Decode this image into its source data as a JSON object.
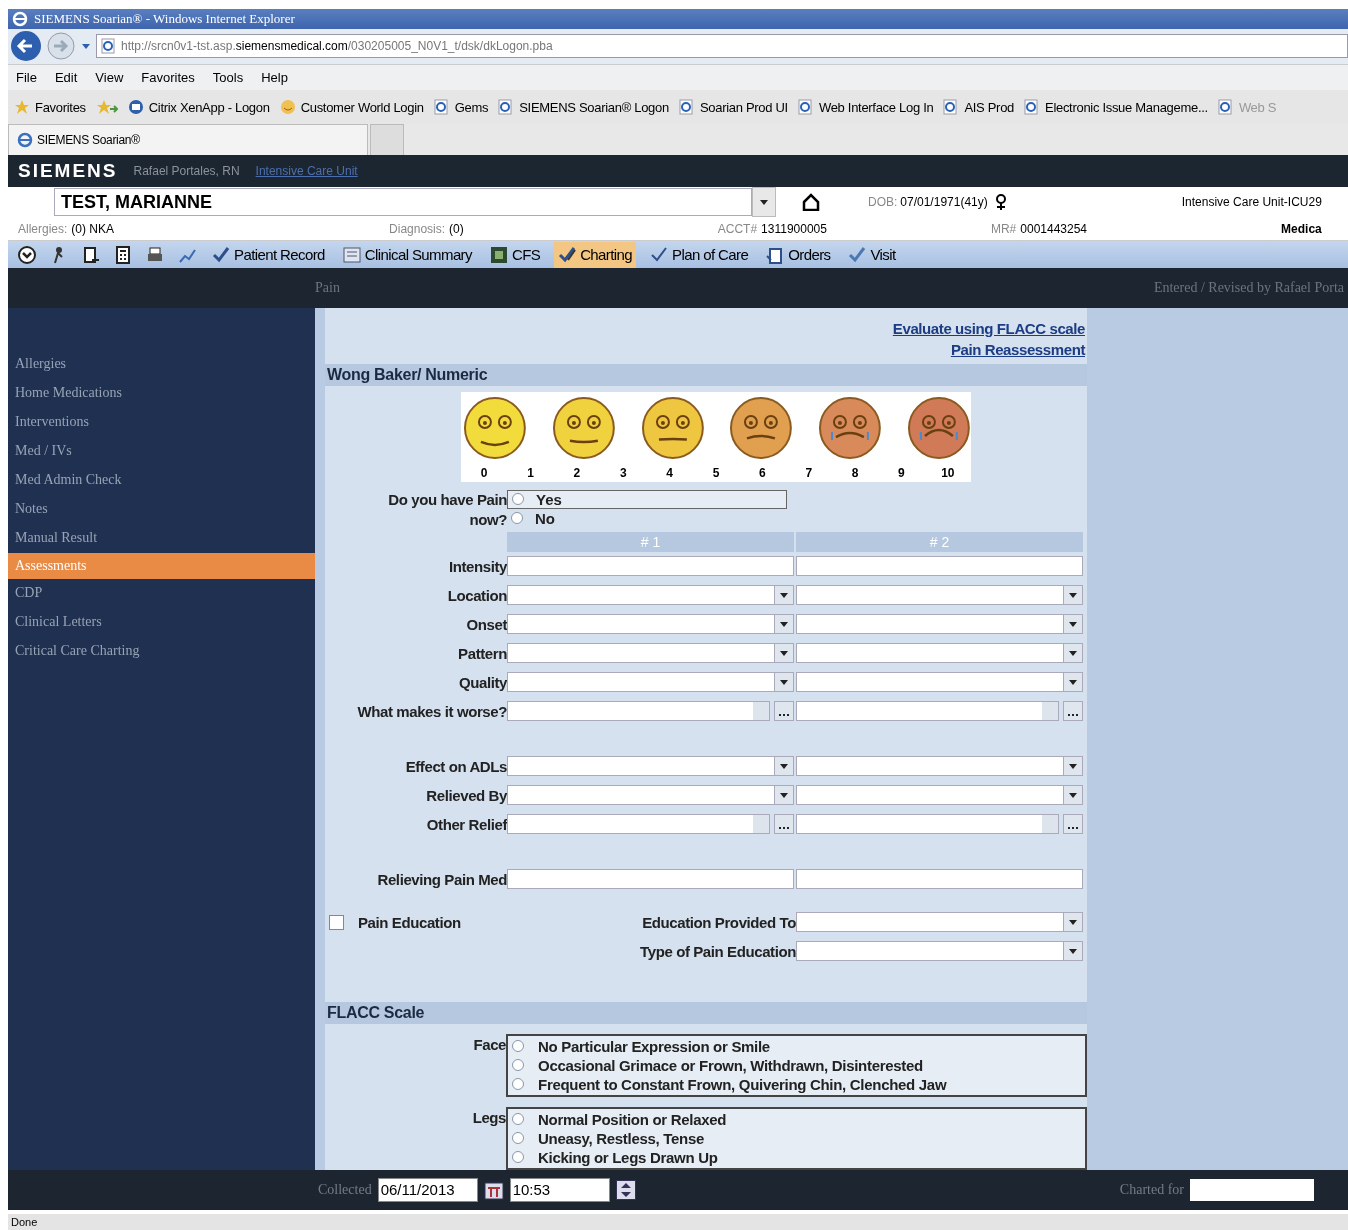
{
  "browser": {
    "title": "SIEMENS Soarian® - Windows Internet Explorer",
    "url": "http://srcn0v1-tst.asp.siemensmedical.com/030205005_N0V1_t/dsk/dkLogon.pba",
    "menu": [
      "File",
      "Edit",
      "View",
      "Favorites",
      "Tools",
      "Help"
    ],
    "favorites_label": "Favorites",
    "bookmarks": [
      {
        "label": "Citrix XenApp - Logon",
        "kind": "citrix"
      },
      {
        "label": "Customer World Login",
        "kind": "smile"
      },
      {
        "label": "Gems",
        "kind": "page"
      },
      {
        "label": "SIEMENS Soarian® Logon",
        "kind": "page"
      },
      {
        "label": "Soarian Prod UI",
        "kind": "page"
      },
      {
        "label": "Web Interface Log In",
        "kind": "page"
      },
      {
        "label": "AIS Prod",
        "kind": "page"
      },
      {
        "label": "Electronic Issue Manageme...",
        "kind": "page"
      },
      {
        "label": "Web S",
        "kind": "page"
      }
    ],
    "tab": "SIEMENS Soarian®",
    "status": "Done"
  },
  "app": {
    "brand": "SIEMENS",
    "user": "Rafael Portales, RN",
    "unit_link": "Intensive Care Unit"
  },
  "patient": {
    "name": "TEST, MARIANNE",
    "dob_label": "DOB:",
    "dob": "07/01/1971(41y)",
    "location": "Intensive Care Unit-ICU29",
    "allergies_label": "Allergies:",
    "allergies": "(0) NKA",
    "diagnosis_label": "Diagnosis:",
    "diagnosis": "(0)",
    "acct_label": "ACCT#",
    "acct": "1311900005",
    "mr_label": "MR#",
    "mr": "0001443254",
    "extra": "Medica"
  },
  "toolbar": {
    "tabs": [
      {
        "label": "Patient Record",
        "selected": false
      },
      {
        "label": "Clinical Summary",
        "selected": false
      },
      {
        "label": "CFS",
        "selected": false
      },
      {
        "label": "Charting",
        "selected": true
      },
      {
        "label": "Plan of Care",
        "selected": false
      },
      {
        "label": "Orders",
        "selected": false
      },
      {
        "label": "Visit",
        "selected": false
      }
    ]
  },
  "sidebar": {
    "items": [
      {
        "label": "Allergies",
        "selected": false
      },
      {
        "label": "Home Medications",
        "selected": false
      },
      {
        "label": "Interventions",
        "selected": false
      },
      {
        "label": "Med / IVs",
        "selected": false
      },
      {
        "label": "Med Admin Check",
        "selected": false
      },
      {
        "label": "Notes",
        "selected": false
      },
      {
        "label": "Manual Result",
        "selected": false
      },
      {
        "label": "Assessments",
        "selected": true
      },
      {
        "label": "CDP",
        "selected": false
      },
      {
        "label": "Clinical Letters",
        "selected": false
      },
      {
        "label": "Critical Care Charting",
        "selected": false
      }
    ]
  },
  "panel": {
    "title": "Pain",
    "entered": "Entered / Revised by  Rafael Porta"
  },
  "form": {
    "links": [
      "Evaluate using FLACC scale",
      "Pain Reassessment"
    ],
    "wong_title": "Wong Baker/ Numeric",
    "faces": [
      {
        "color": "#f2dc3c"
      },
      {
        "color": "#f0d23e"
      },
      {
        "color": "#eec640"
      },
      {
        "color": "#e0a050"
      },
      {
        "color": "#d98a5a"
      },
      {
        "color": "#d07a58"
      }
    ],
    "scale": [
      "0",
      "1",
      "2",
      "3",
      "4",
      "5",
      "6",
      "7",
      "8",
      "9",
      "10"
    ],
    "pain_question": "Do you have Pain now?",
    "pain_options": [
      {
        "label": "Yes",
        "selected": false
      },
      {
        "label": "No",
        "selected": false
      }
    ],
    "columns": [
      "# 1",
      "# 2"
    ],
    "row_groups": [
      [
        {
          "label": "Intensity",
          "kind": "text"
        },
        {
          "label": "Location",
          "kind": "select"
        },
        {
          "label": "Onset",
          "kind": "select"
        },
        {
          "label": "Pattern",
          "kind": "select"
        },
        {
          "label": "Quality",
          "kind": "select"
        },
        {
          "label": "What makes it worse?",
          "kind": "lookup"
        }
      ],
      [
        {
          "label": "Effect on ADLs",
          "kind": "select"
        },
        {
          "label": "Relieved By",
          "kind": "select"
        },
        {
          "label": "Other Relief",
          "kind": "lookup"
        }
      ],
      [
        {
          "label": "Relieving Pain Med",
          "kind": "text"
        }
      ]
    ],
    "education": {
      "label": "Pain Education",
      "checked": false,
      "fields": [
        "Education Provided To",
        "Type of Pain Education"
      ]
    },
    "flacc_title": "FLACC Scale",
    "flacc": [
      {
        "label": "Face",
        "options": [
          {
            "label": "No Particular Expression or Smile",
            "selected": false
          },
          {
            "label": "Occasional Grimace or Frown, Withdrawn, Disinterested",
            "selected": false
          },
          {
            "label": "Frequent to Constant Frown, Quivering Chin, Clenched Jaw",
            "selected": false
          }
        ]
      },
      {
        "label": "Legs",
        "options": [
          {
            "label": "Normal Position or Relaxed",
            "selected": false
          },
          {
            "label": "Uneasy, Restless, Tense",
            "selected": false
          },
          {
            "label": "Kicking or Legs Drawn Up",
            "selected": false
          }
        ]
      }
    ]
  },
  "footer": {
    "collected_label": "Collected",
    "date": "06/11/2013",
    "time": "10:53",
    "charted_label": "Charted for"
  }
}
